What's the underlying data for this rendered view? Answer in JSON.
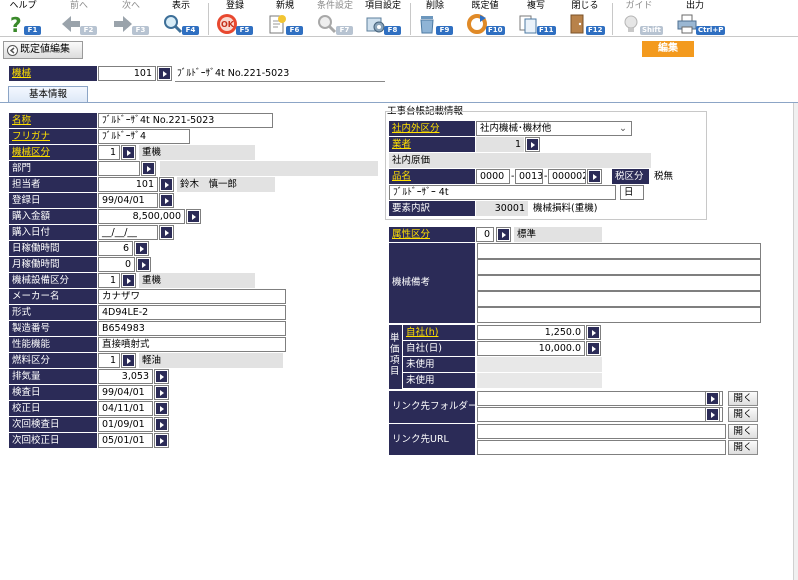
{
  "toolbar": {
    "help": {
      "label": "ヘルプ",
      "key": "F1"
    },
    "prev": {
      "label": "前へ",
      "key": "F2"
    },
    "next": {
      "label": "次へ",
      "key": "F3"
    },
    "view": {
      "label": "表示",
      "key": "F4"
    },
    "register": {
      "label": "登録",
      "key": "F5"
    },
    "new": {
      "label": "新規",
      "key": "F6"
    },
    "condition": {
      "label": "条件設定",
      "key": "F7"
    },
    "item_settings": {
      "label": "項目設定",
      "key": "F8"
    },
    "delete": {
      "label": "削除",
      "key": "F9"
    },
    "default_value": {
      "label": "既定値",
      "key": "F10"
    },
    "copy": {
      "label": "複写",
      "key": "F11"
    },
    "close": {
      "label": "閉じる",
      "key": "F12"
    },
    "guide": {
      "label": "ガイド",
      "key": "Shift"
    },
    "output": {
      "label": "出力",
      "key": "Ctrl+P"
    }
  },
  "default_edit_button": "既定値編集",
  "mode_badge": "編集",
  "machine": {
    "label": "機械",
    "code": "101",
    "name": "ﾌﾞﾙﾄﾞｰｻﾞ4t No.221-5023"
  },
  "tab": "基本情報",
  "left": {
    "name": {
      "label": "名称",
      "value": "ﾌﾞﾙﾄﾞｰｻﾞ4t No.221-5023"
    },
    "kana": {
      "label": "フリガナ",
      "value": "ﾌﾞﾙﾄﾞｰｻﾞ4"
    },
    "category": {
      "label": "機械区分",
      "code": "1",
      "name": "重機"
    },
    "department": {
      "label": "部門",
      "code": "",
      "name": ""
    },
    "person": {
      "label": "担当者",
      "code": "101",
      "name": "鈴木　慎一郎"
    },
    "reg_date": {
      "label": "登録日",
      "value": "99/04/01"
    },
    "price": {
      "label": "購入金額",
      "value": "8,500,000"
    },
    "purchase_date": {
      "label": "購入日付",
      "value": "__/__/__"
    },
    "daily_hours": {
      "label": "日稼働時間",
      "value": "6"
    },
    "monthly_hours": {
      "label": "月稼働時間",
      "value": "0"
    },
    "equip_category": {
      "label": "機械設備区分",
      "code": "1",
      "name": "重機"
    },
    "maker": {
      "label": "メーカー名",
      "value": "カナザワ"
    },
    "model": {
      "label": "形式",
      "value": "4D94LE-2"
    },
    "serial": {
      "label": "製造番号",
      "value": "B654983"
    },
    "performance": {
      "label": "性能機能",
      "value": "直接噴射式"
    },
    "fuel": {
      "label": "燃料区分",
      "code": "1",
      "name": "軽油"
    },
    "displacement": {
      "label": "排気量",
      "value": "3,053"
    },
    "inspection": {
      "label": "検査日",
      "value": "99/04/01"
    },
    "calibration": {
      "label": "校正日",
      "value": "04/11/01"
    },
    "next_inspection": {
      "label": "次回検査日",
      "value": "01/09/01"
    },
    "next_calibration": {
      "label": "次回校正日",
      "value": "05/01/01"
    }
  },
  "right": {
    "section_title": "工事台帳記載情報",
    "inout": {
      "label": "社内外区分",
      "value": "社内機械･機材他"
    },
    "vendor": {
      "label": "業者",
      "code": "1"
    },
    "cost_label": "社内原価",
    "item": {
      "label": "品名",
      "code1": "0000",
      "code2": "0013",
      "code3": "000002"
    },
    "tax": {
      "label": "税区分",
      "value": "税無"
    },
    "item_name": "ﾌﾞﾙﾄﾞｰｻﾞｰ 4t",
    "unit": "日",
    "element": {
      "label": "要素内訳",
      "code": "30001",
      "name": "機械損料(重機)"
    },
    "attribute": {
      "label": "属性区分",
      "code": "0",
      "name": "標準"
    },
    "remarks_label": "機械備考",
    "unit_price": {
      "group_label": "単価項目",
      "own_hour": {
        "label": "自社(h)",
        "value": "1,250.0"
      },
      "own_day": {
        "label": "自社(日)",
        "value": "10,000.0"
      },
      "unused1": "未使用",
      "unused2": "未使用"
    },
    "link_folder": "リンク先フォルダー",
    "link_url": "リンク先URL",
    "open_label": "開く"
  }
}
